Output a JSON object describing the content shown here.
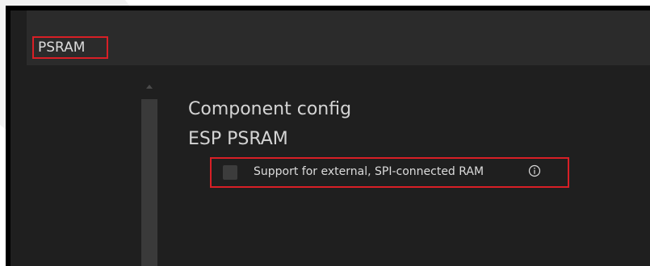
{
  "header": {
    "title": "PSRAM"
  },
  "content": {
    "section_path": [
      "Component config",
      "ESP PSRAM"
    ],
    "option": {
      "label": "Support for external, SPI-connected RAM",
      "checked": false,
      "icon": "info-icon"
    }
  },
  "colors": {
    "highlight": "#d81f26",
    "background": "#1f1f1f",
    "header_background": "#2b2b2b",
    "text": "#d4d4d4"
  }
}
